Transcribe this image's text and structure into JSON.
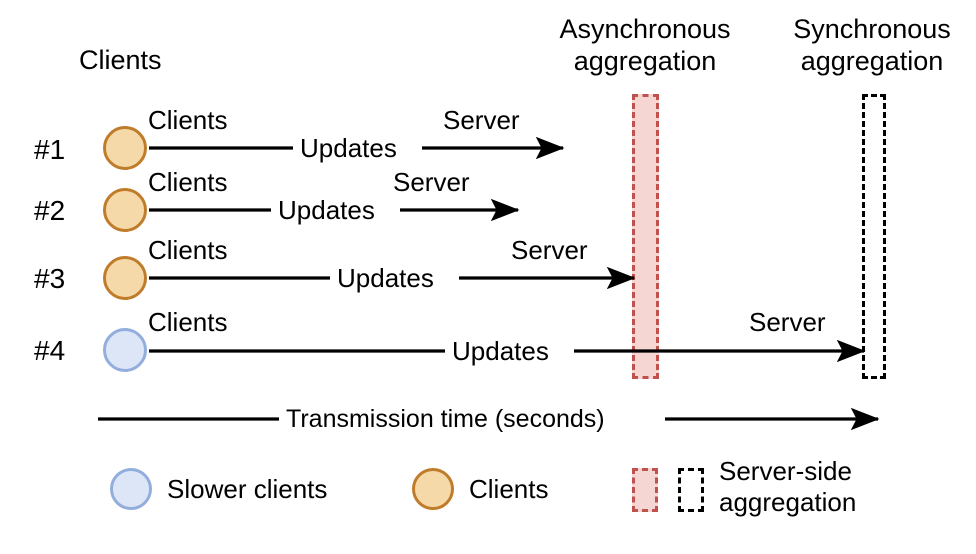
{
  "diagram": {
    "title_clients": "Clients",
    "headers": [
      {
        "id": "async",
        "line1": "Asynchronous",
        "line2": "aggregation"
      },
      {
        "id": "sync",
        "line1": "Synchronous",
        "line2": "aggregation"
      }
    ],
    "rows": [
      {
        "id": "row-1",
        "number": "#1",
        "client_type": "client",
        "label_clients": "Clients",
        "label_updates": "Updates",
        "label_server": "Server"
      },
      {
        "id": "row-2",
        "number": "#2",
        "client_type": "client",
        "label_clients": "Clients",
        "label_updates": "Updates",
        "label_server": "Server"
      },
      {
        "id": "row-3",
        "number": "#3",
        "client_type": "client",
        "label_clients": "Clients",
        "label_updates": "Updates",
        "label_server": "Server"
      },
      {
        "id": "row-4",
        "number": "#4",
        "client_type": "slower-client",
        "label_clients": "Clients",
        "label_updates": "Updates",
        "label_server": "Server"
      }
    ],
    "axis": {
      "label": "Transmission time (seconds)"
    },
    "legend": {
      "slower_clients": "Slower clients",
      "clients": "Clients",
      "server_side_line1": "Server-side",
      "server_side_line2": "aggregation"
    },
    "colors": {
      "client_fill": "#F6D9A8",
      "client_stroke": "#BF7D2C",
      "slower_client_fill": "#DCE6F7",
      "slower_client_stroke": "#93AEDC",
      "async_box_fill": "#F6D6D2",
      "async_box_stroke": "#C0514D",
      "sync_box_stroke": "#000000",
      "line": "#000000",
      "text": "#000000",
      "background": "#FFFFFF"
    }
  }
}
